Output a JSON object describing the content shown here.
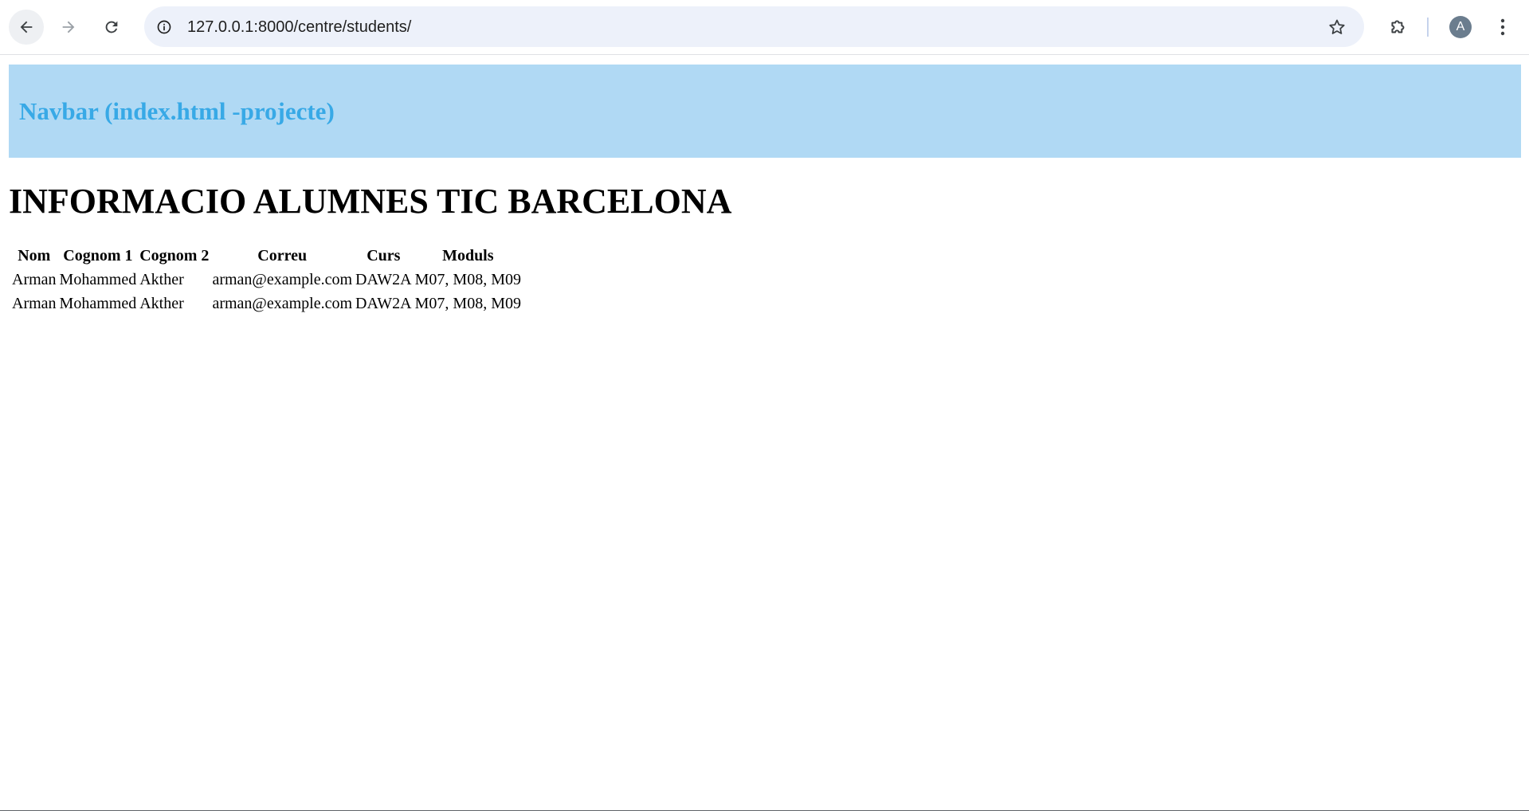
{
  "browser": {
    "url": "127.0.0.1:8000/centre/students/",
    "profile_initial": "A",
    "icons": {
      "back": "arrow-left-icon",
      "forward": "arrow-right-icon",
      "reload": "reload-icon",
      "site_info": "info-icon",
      "bookmark": "star-icon",
      "extensions": "puzzle-icon",
      "menu": "kebab-menu-icon"
    }
  },
  "navbar": {
    "title": "Navbar (index.html -projecte)",
    "background_color": "#b0d9f4",
    "text_color": "#38a9e6"
  },
  "main": {
    "title": "INFORMACIO ALUMNES TIC BARCELONA",
    "table": {
      "headers": [
        "Nom",
        "Cognom 1",
        "Cognom 2",
        "Correu",
        "Curs",
        "Moduls"
      ],
      "rows": [
        [
          "Arman",
          "Mohammed",
          "Akther",
          "arman@example.com",
          "DAW2A",
          "M07, M08, M09"
        ],
        [
          "Arman",
          "Mohammed",
          "Akther",
          "arman@example.com",
          "DAW2A",
          "M07, M08, M09"
        ]
      ]
    }
  }
}
